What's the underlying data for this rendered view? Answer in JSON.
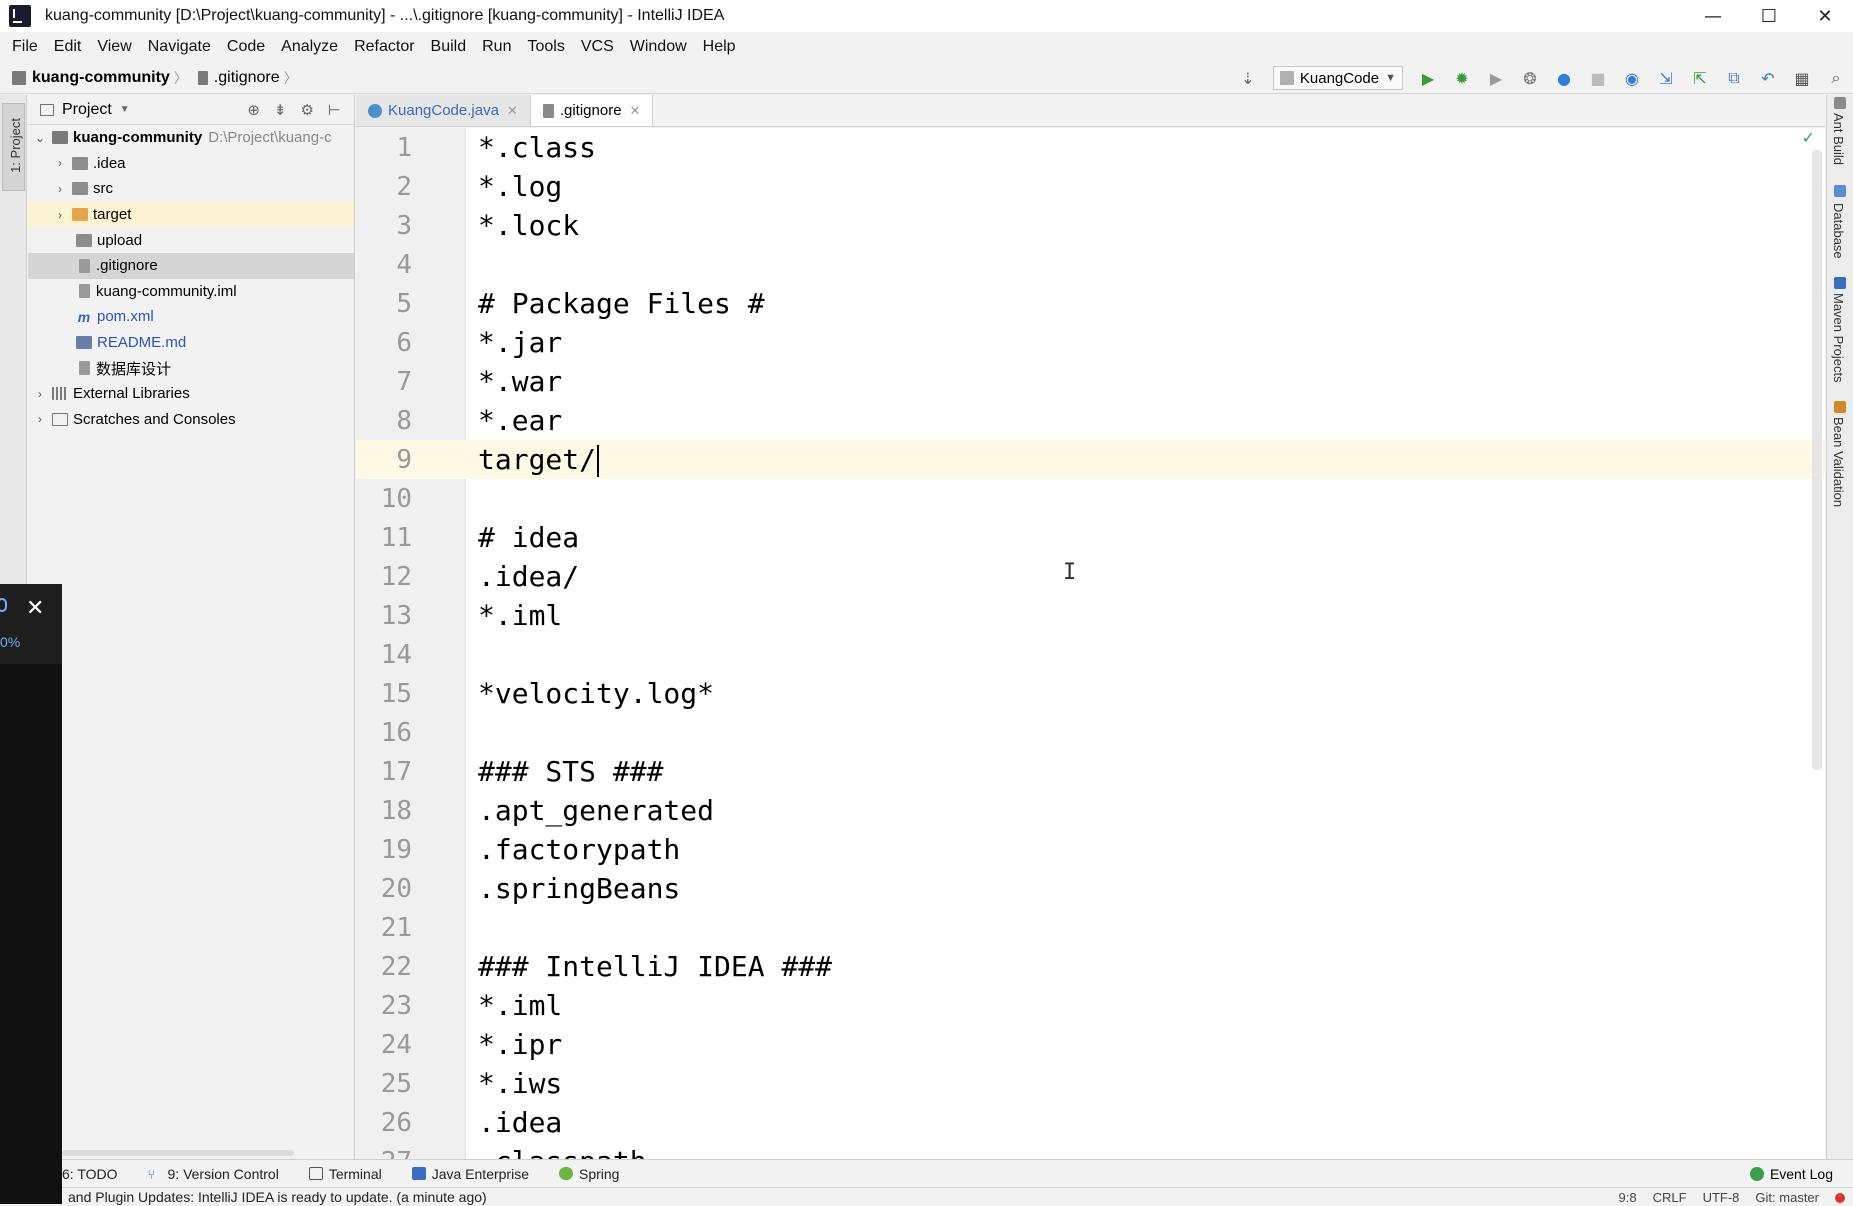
{
  "window": {
    "title": "kuang-community [D:\\Project\\kuang-community] - ...\\.gitignore [kuang-community] - IntelliJ IDEA",
    "minimize": "—",
    "maximize": "☐",
    "close": "✕"
  },
  "menu": [
    "File",
    "Edit",
    "View",
    "Navigate",
    "Code",
    "Analyze",
    "Refactor",
    "Build",
    "Run",
    "Tools",
    "VCS",
    "Window",
    "Help"
  ],
  "breadcrumb": {
    "project": "kuang-community",
    "file": ".gitignore"
  },
  "toolbar": {
    "run_config": "KuangCode"
  },
  "left_strip": {
    "label": "1: Project"
  },
  "project_panel": {
    "title": "Project",
    "tree": [
      {
        "label": "kuang-community",
        "hint": "D:\\Project\\kuang-c",
        "depth": 0,
        "expanded": true,
        "icon": "module"
      },
      {
        "label": ".idea",
        "depth": 1,
        "expanded": false,
        "icon": "folder"
      },
      {
        "label": "src",
        "depth": 1,
        "expanded": false,
        "icon": "folder"
      },
      {
        "label": "target",
        "depth": 1,
        "expanded": false,
        "icon": "folder-orange"
      },
      {
        "label": "upload",
        "depth": 1,
        "icon": "folder"
      },
      {
        "label": ".gitignore",
        "depth": 1,
        "icon": "file"
      },
      {
        "label": "kuang-community.iml",
        "depth": 1,
        "icon": "file"
      },
      {
        "label": "pom.xml",
        "depth": 1,
        "icon": "maven"
      },
      {
        "label": "README.md",
        "depth": 1,
        "icon": "md"
      },
      {
        "label": "数据库设计",
        "depth": 1,
        "icon": "file"
      },
      {
        "label": "External Libraries",
        "depth": 0,
        "expanded": false,
        "icon": "libs"
      },
      {
        "label": "Scratches and Consoles",
        "depth": 0,
        "expanded": false,
        "icon": "scratch"
      }
    ]
  },
  "popup": {
    "text": "0%",
    "close": "✕"
  },
  "tabs": [
    {
      "label": "KuangCode.java",
      "active": false
    },
    {
      "label": ".gitignore",
      "active": true
    }
  ],
  "editor": {
    "current_line": 9,
    "lines": [
      "*.class",
      "*.log",
      "*.lock",
      "",
      "# Package Files #",
      "*.jar",
      "*.war",
      "*.ear",
      "target/",
      "",
      "# idea",
      ".idea/",
      "*.iml",
      "",
      "*velocity.log*",
      "",
      "### STS ###",
      ".apt_generated",
      ".factorypath",
      ".springBeans",
      "",
      "### IntelliJ IDEA ###",
      "*.iml",
      "*.ipr",
      "*.iws",
      ".idea",
      ".classpath"
    ]
  },
  "right_strip": [
    "Ant Build",
    "Database",
    "Maven Projects",
    "Bean Validation"
  ],
  "bottom_bar": {
    "items": [
      "6: TODO",
      "9: Version Control",
      "Terminal",
      "Java Enterprise",
      "Spring"
    ],
    "event_log": "Event Log"
  },
  "status_bar": {
    "message": "and Plugin Updates: IntelliJ IDEA is ready to update. (a minute ago)",
    "position": "9:8",
    "line_sep": "CRLF",
    "encoding": "UTF-8",
    "git": "Git: master"
  }
}
